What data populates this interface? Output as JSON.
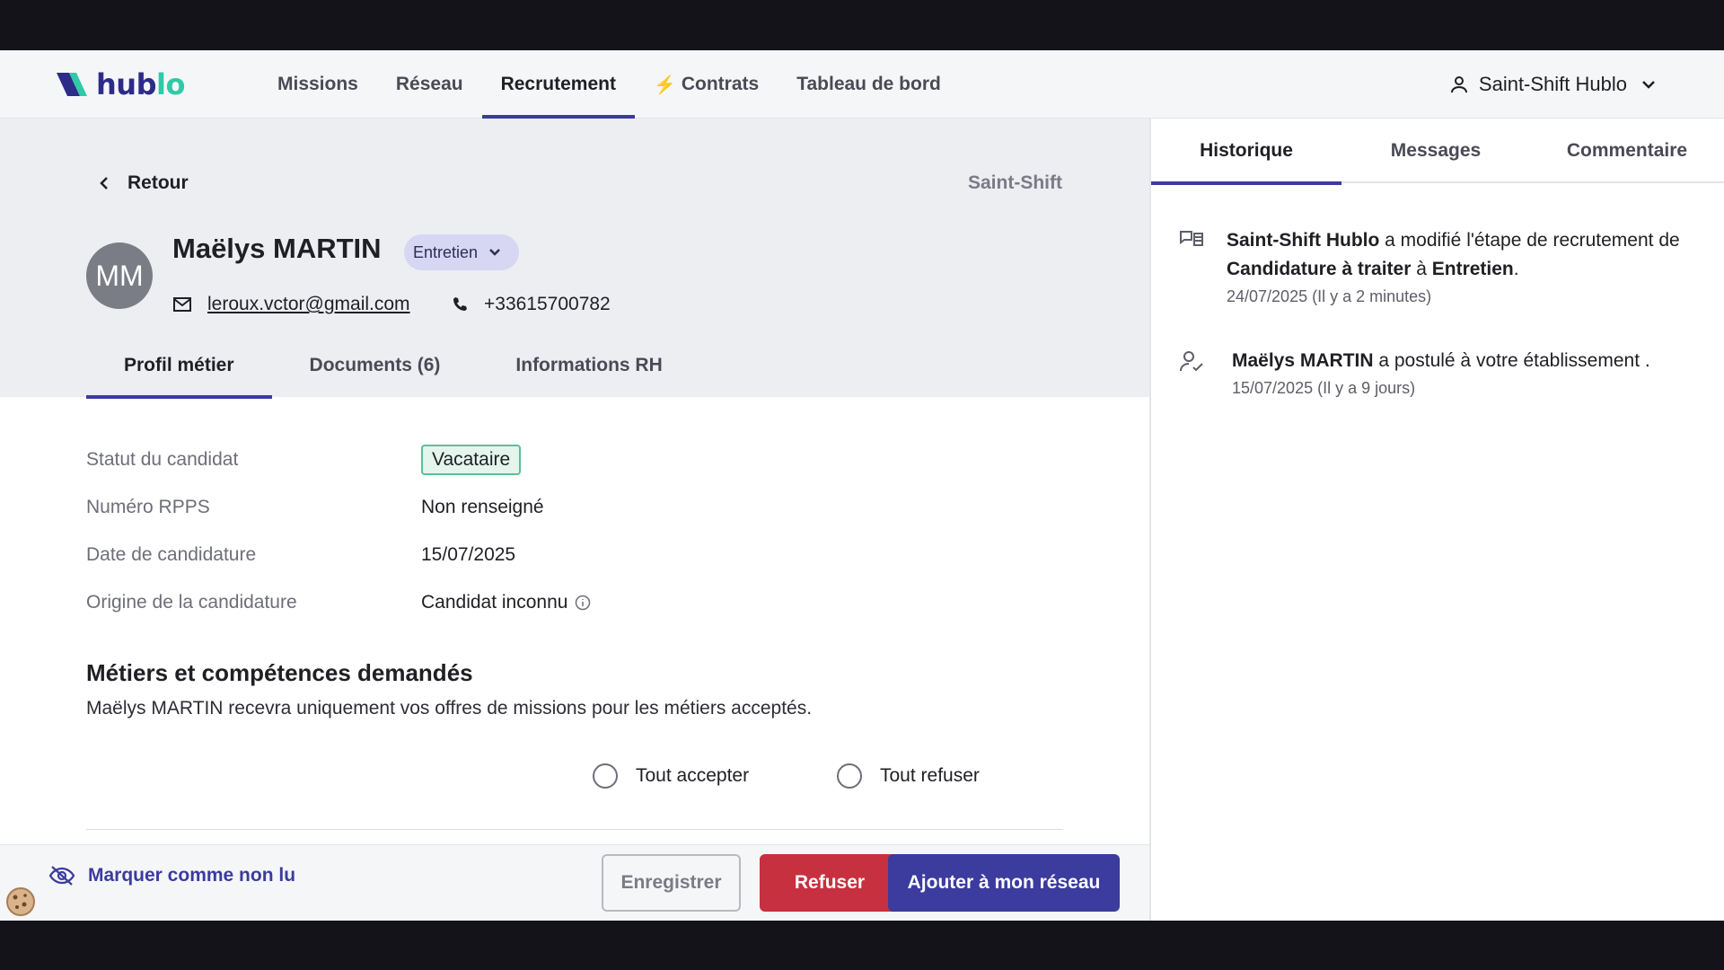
{
  "header": {
    "logo_prefix": "hub",
    "logo_suffix": "lo",
    "nav": [
      {
        "label": "Missions",
        "active": false
      },
      {
        "label": "Réseau",
        "active": false
      },
      {
        "label": "Recrutement",
        "active": true
      },
      {
        "label": "Contrats",
        "active": false,
        "icon": "bolt-icon"
      },
      {
        "label": "Tableau de bord",
        "active": false
      }
    ],
    "user_name": "Saint-Shift Hublo"
  },
  "profile": {
    "back_label": "Retour",
    "site_label": "Saint-Shift",
    "avatar_initials": "MM",
    "name": "Maëlys MARTIN",
    "stage": "Entretien",
    "email": "leroux.vctor@gmail.com",
    "phone": "+33615700782",
    "tabs": [
      {
        "label": "Profil métier",
        "active": true
      },
      {
        "label": "Documents (6)",
        "active": false
      },
      {
        "label": "Informations RH",
        "active": false
      }
    ],
    "fields": [
      {
        "label": "Statut du candidat",
        "value": "Vacataire"
      },
      {
        "label": "Numéro RPPS",
        "value": "Non renseigné"
      },
      {
        "label": "Date de candidature",
        "value": "15/07/2025"
      },
      {
        "label": "Origine de la candidature",
        "value": "Candidat inconnu"
      }
    ]
  },
  "skills": {
    "title": "Métiers et compétences demandés",
    "description": "Maëlys MARTIN recevra uniquement vos offres de missions pour les métiers acceptés.",
    "accept_all": "Tout accepter",
    "refuse_all": "Tout refuser"
  },
  "footer": {
    "mark_unread": "Marquer comme non lu",
    "save": "Enregistrer",
    "refuse": "Refuser",
    "add": "Ajouter à mon réseau"
  },
  "side": {
    "tabs": [
      {
        "label": "Historique",
        "active": true
      },
      {
        "label": "Messages",
        "active": false
      },
      {
        "label": "Commentaire",
        "active": false
      }
    ],
    "history": [
      {
        "actor": "Saint-Shift Hublo",
        "text1": " a modifié l'étape de recrutement de ",
        "from": "Candidature à traiter",
        "text2": " à ",
        "to": "Entretien",
        "text3": ".",
        "date": "24/07/2025 (Il y a 2 minutes)"
      },
      {
        "actor": "Maëlys MARTIN",
        "text1": " a postulé à votre établissement .",
        "date": "15/07/2025 (Il y a 9 jours)"
      }
    ]
  },
  "colors": {
    "accent": "#3c3b9e",
    "danger": "#c7303f",
    "badge_border": "#5cbf97",
    "logo_teal": "#2fc9a8"
  }
}
